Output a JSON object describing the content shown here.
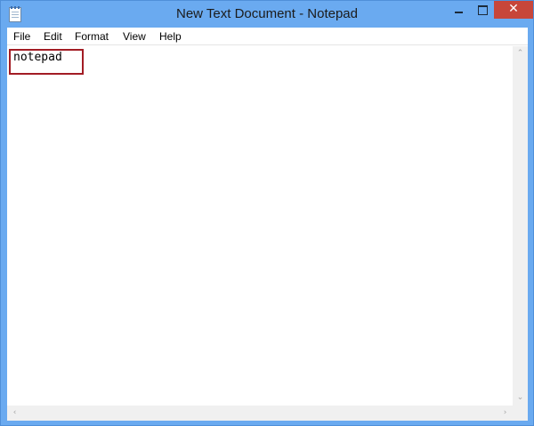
{
  "window": {
    "title": "New Text Document - Notepad",
    "close_glyph": "✕",
    "accent": "#6aaaf0",
    "close_color": "#c7463a"
  },
  "menu": {
    "items": [
      "File",
      "Edit",
      "Format",
      "View",
      "Help"
    ]
  },
  "editor": {
    "content": "notepad",
    "highlight_color": "#a21c24"
  },
  "scrollbar": {
    "up_glyph": "⌃",
    "down_glyph": "⌄",
    "left_glyph": "‹",
    "right_glyph": "›"
  },
  "icons": {
    "app": "notepad-icon",
    "minimize": "minimize-icon",
    "maximize": "maximize-icon",
    "close": "close-icon"
  }
}
